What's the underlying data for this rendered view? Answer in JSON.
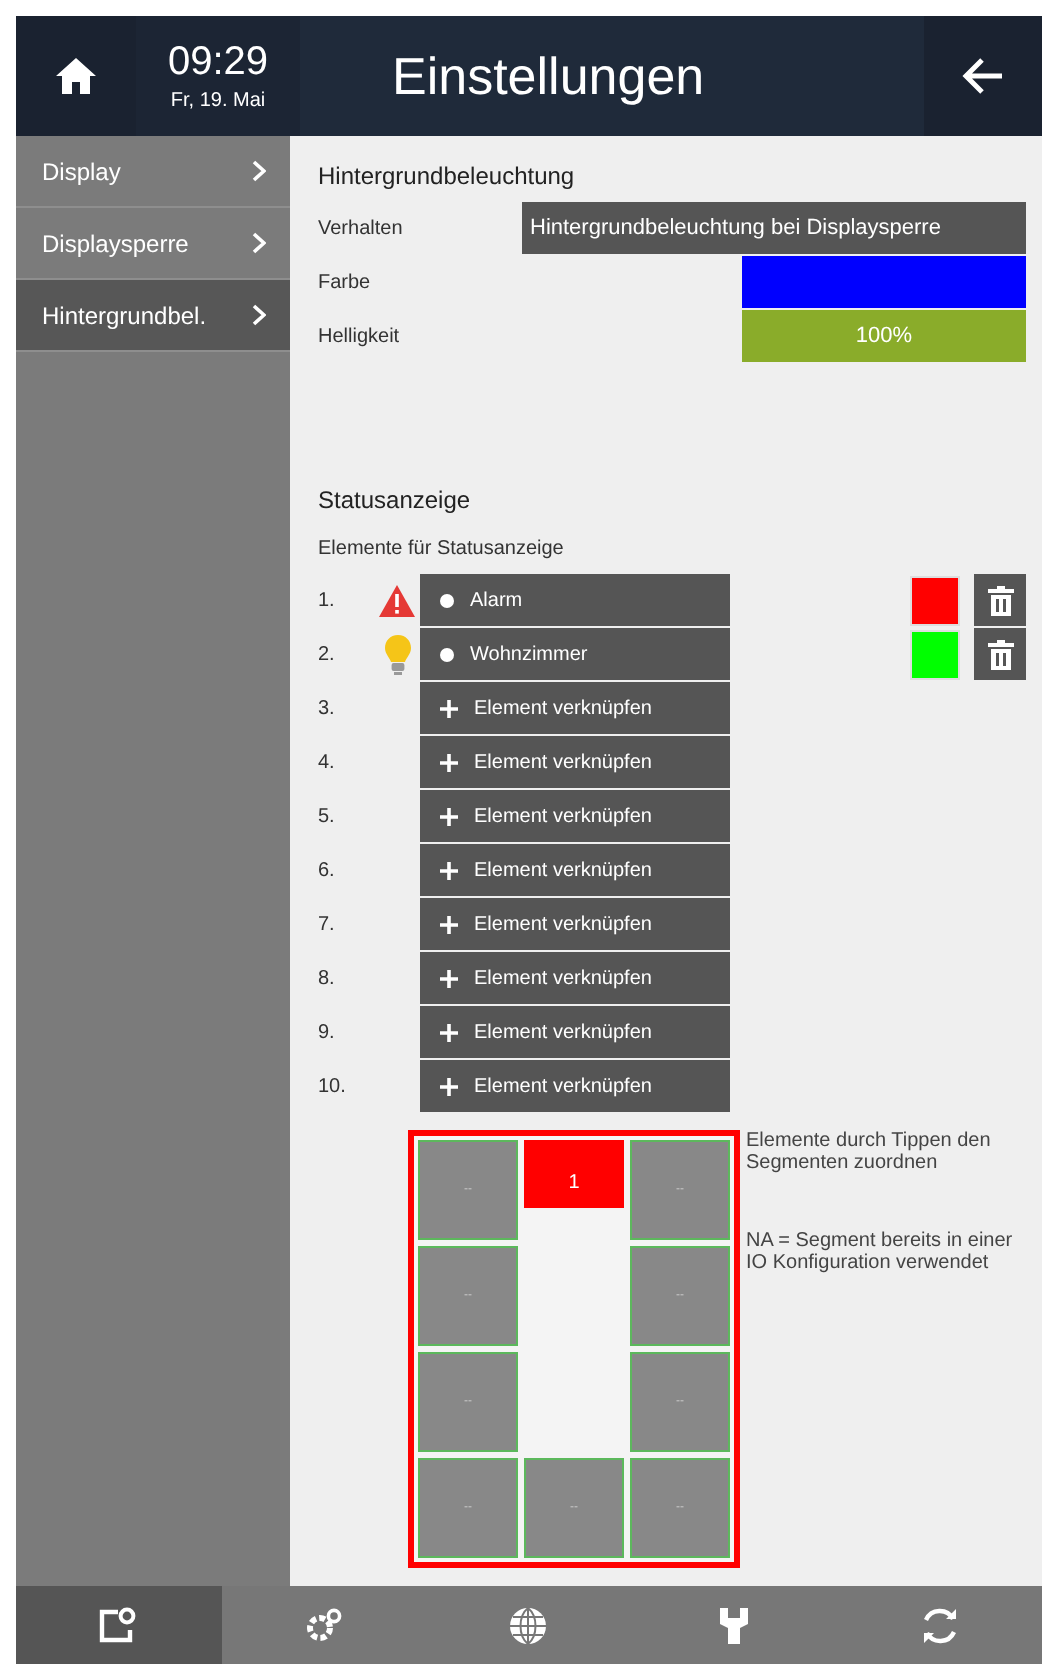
{
  "header": {
    "time": "09:29",
    "date": "Fr, 19. Mai",
    "title": "Einstellungen"
  },
  "sidebar": {
    "items": [
      {
        "label": "Display",
        "selected": false
      },
      {
        "label": "Displaysperre",
        "selected": false
      },
      {
        "label": "Hintergrundbel.",
        "selected": true
      }
    ]
  },
  "backlight": {
    "title": "Hintergrundbeleuchtung",
    "behavior": {
      "label": "Verhalten",
      "value": "Hintergrundbeleuchtung bei Displaysperre"
    },
    "color": {
      "label": "Farbe",
      "color": "#0000ff"
    },
    "brightness": {
      "label": "Helligkeit",
      "level": 1,
      "reading": "100%"
    }
  },
  "status": {
    "title": "Statusanzeige",
    "subtitle": "Elemente für Statusanzeige",
    "elements": [
      {
        "number": "1.",
        "kind": "assigned",
        "label": "Alarm",
        "color": "#ff0000"
      },
      {
        "number": "2.",
        "kind": "assigned",
        "label": "Wohnzimmer",
        "color": "#00ff00"
      },
      {
        "number": "3.",
        "kind": "empty",
        "label": "Element verknüpfen"
      },
      {
        "number": "4.",
        "kind": "empty",
        "label": "Element verknüpfen"
      },
      {
        "number": "5.",
        "kind": "empty",
        "label": "Element verknüpfen"
      },
      {
        "number": "6.",
        "kind": "empty",
        "label": "Element verknüpfen"
      },
      {
        "number": "7.",
        "kind": "empty",
        "label": "Element verknüpfen"
      },
      {
        "number": "8.",
        "kind": "empty",
        "label": "Element verknüpfen"
      },
      {
        "number": "9.",
        "kind": "empty",
        "label": "Element verknüpfen"
      },
      {
        "number": "10.",
        "kind": "empty",
        "label": "Element verknüpfen"
      }
    ]
  },
  "segments": {
    "cells": [
      {
        "kind": "segment",
        "label": "--"
      },
      {
        "kind": "segment",
        "label": "1",
        "color": "#ff0000"
      },
      {
        "kind": "segment",
        "label": "--"
      },
      {
        "kind": "segment",
        "label": "--"
      },
      {
        "kind": "gap"
      },
      {
        "kind": "segment",
        "label": "--"
      },
      {
        "kind": "segment",
        "label": "--"
      },
      {
        "kind": "gap"
      },
      {
        "kind": "segment",
        "label": "--"
      },
      {
        "kind": "segment",
        "label": "--"
      },
      {
        "kind": "segment",
        "label": "--"
      },
      {
        "kind": "segment",
        "label": "--"
      }
    ],
    "hints": [
      "Elemente durch Tippen den Segmenten zuordnen",
      "NA = Segment bereits in einer IO Konfiguration verwendet"
    ]
  },
  "bottom_bar": {
    "tabs": [
      {
        "selected": true
      },
      {
        "selected": false
      },
      {
        "selected": false
      },
      {
        "selected": false
      },
      {
        "selected": false
      }
    ]
  }
}
